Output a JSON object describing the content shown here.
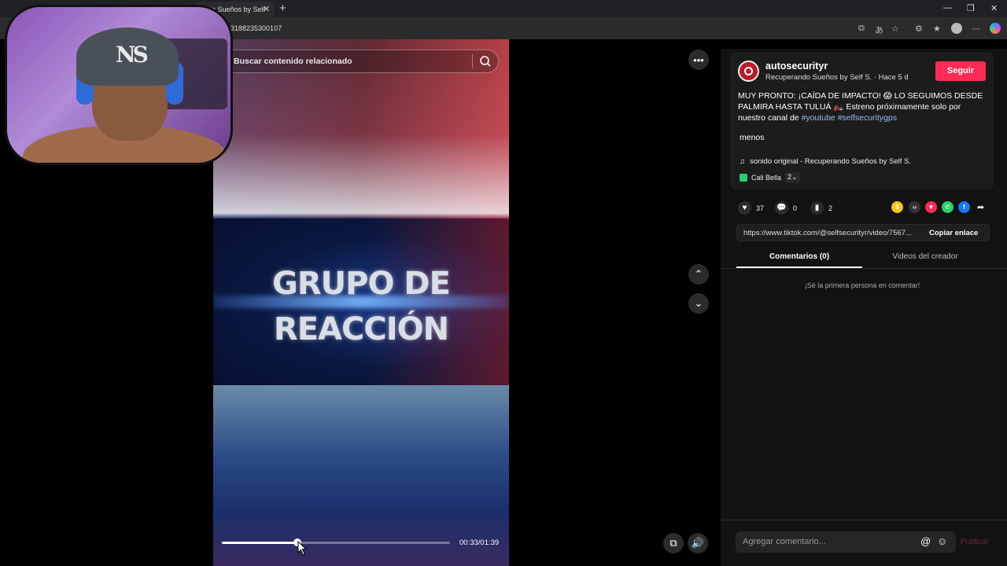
{
  "browser": {
    "tab_title": "do Sueños by Self",
    "url": "53188235300107"
  },
  "search": {
    "placeholder": "Buscar contenido relacionado"
  },
  "video": {
    "title_line1": "GRUPO DE",
    "title_line2": "REACCIÓN",
    "time": "00:33/01:39",
    "progress_fraction": 0.33
  },
  "creator": {
    "username": "autosecurityr",
    "subline": "Recuperando Sueños by Self S. · Hace 5 d",
    "follow_label": "Seguir"
  },
  "caption": {
    "text": "MUY PRONTO: ¡CAÍDA DE IMPACTO! 😱 LO SEGUIMOS DESDE PALMIRA HASTA TULUÁ 🏍️ Estreno próximamente solo por nuestro canal de ",
    "tag1": "#youtube",
    "tag2": "#selfsecuritygps",
    "less_label": "menos"
  },
  "music": {
    "label": "sonido original - Recuperando Sueños by Self S."
  },
  "collab": {
    "name": "Cali Bella",
    "count": "2"
  },
  "stats": {
    "likes": "37",
    "comments": "0",
    "saves": "2"
  },
  "share": {
    "url": "https://www.tiktok.com/@selfsecurityr/video/7567...",
    "copy_label": "Copiar enlace"
  },
  "tabs": {
    "comments": "Comentarios (0)",
    "videos": "Videos del creador"
  },
  "comments": {
    "empty_text": "¡Sé la primera persona en comentar!",
    "input_placeholder": "Agregar comentario...",
    "publish_label": "Publicar"
  },
  "colors": {
    "accent": "#fe2c55",
    "tag": "#8fbfff"
  },
  "icons": [
    "search-icon",
    "more-icon",
    "chevron-up-icon",
    "chevron-down-icon",
    "heart-icon",
    "comment-icon",
    "bookmark-icon",
    "share-arrow-icon",
    "volume-icon",
    "pip-icon",
    "music-note-icon",
    "at-icon",
    "emoji-icon"
  ]
}
